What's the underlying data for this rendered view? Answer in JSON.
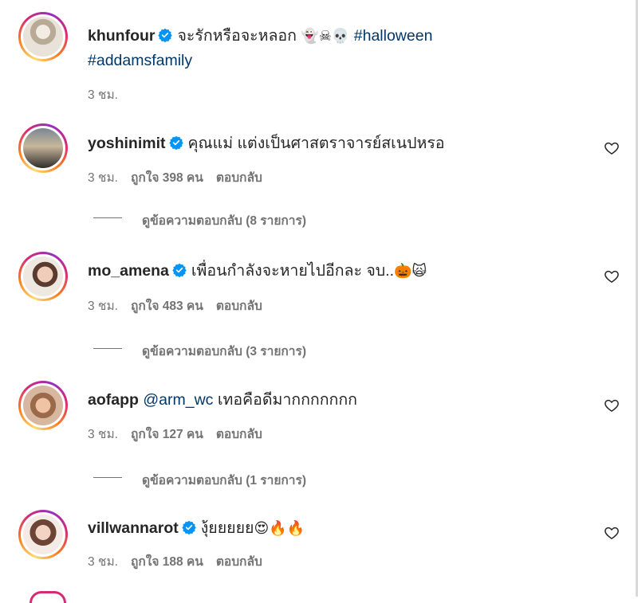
{
  "post": {
    "username": "khunfour",
    "caption_text": "จะรักหรือจะหลอก",
    "caption_emojis": "👻☠💀",
    "hashtag1": "#halloween",
    "hashtag2": "#addamsfamily",
    "time": "3 ชม."
  },
  "comments": [
    {
      "username": "yoshinimit",
      "text": "คุณแม่ แต่งเป็นศาสตราจารย์สเนปหรอ",
      "time": "3 ชม.",
      "likes": "ถูกใจ 398 คน",
      "reply": "ตอบกลับ",
      "view_replies": "ดูข้อความตอบกลับ (8 รายการ)"
    },
    {
      "username": "mo_amena",
      "text": "เพื่อนกำลังจะหายไปอีกละ จบ..",
      "emojis": "🎃🙀",
      "time": "3 ชม.",
      "likes": "ถูกใจ 483 คน",
      "reply": "ตอบกลับ",
      "view_replies": "ดูข้อความตอบกลับ (3 รายการ)"
    },
    {
      "username": "aofapp",
      "mention": "@arm_wc",
      "text": "เทอคือดีมากกกกกกก",
      "time": "3 ชม.",
      "likes": "ถูกใจ 127 คน",
      "reply": "ตอบกลับ",
      "view_replies": "ดูข้อความตอบกลับ (1 รายการ)"
    },
    {
      "username": "villwannarot",
      "text": "งุ้ยยยยย",
      "emojis": "😍🔥🔥",
      "time": "3 ชม.",
      "likes": "ถูกใจ 188 คน",
      "reply": "ตอบกลับ"
    }
  ],
  "icons": {
    "verified": "verified-badge-icon",
    "like": "heart-outline-icon"
  },
  "colors": {
    "verified": "#0095f6",
    "link": "#00376b",
    "meta": "#737373",
    "text": "#262626"
  }
}
